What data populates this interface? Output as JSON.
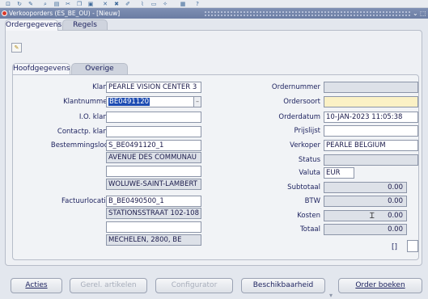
{
  "toolbar": {
    "icons": [
      "save-icon",
      "refresh-icon",
      "pen-icon",
      "zoom-icon",
      "print-icon",
      "cut-icon",
      "copy-icon",
      "paste-icon",
      "clear-icon",
      "delete-icon",
      "edit-icon",
      "attach-icon",
      "folder-icon",
      "help-icon",
      "window-icon",
      "question-icon"
    ]
  },
  "window": {
    "title": "Verkooporders (ES_BE_OU) - [Nieuw]",
    "minimize": "⌄",
    "restore": "⬚"
  },
  "tabs": {
    "ordergegevens": "Ordergegevens",
    "regels": "Regels"
  },
  "subtabs": {
    "hoofdgegevens": "Hoofdgegevens",
    "overige": "Overige"
  },
  "form": {
    "klant": {
      "label": "Klant",
      "value": "PEARLE VISION CENTER 3"
    },
    "klantnummer": {
      "label": "Klantnummer",
      "value": "BE0491120"
    },
    "io_klant": {
      "label": "I.O. klant",
      "value": ""
    },
    "contactp_klant": {
      "label": "Contactp. klant",
      "value": ""
    },
    "bestemmingsloc": {
      "label": "Bestemmingsloc.",
      "value": "S_BE0491120_1"
    },
    "adres_bestemming": [
      "AVENUE DES COMMUNAU",
      "",
      "WOLUWE-SAINT-LAMBERT"
    ],
    "factuurlocatie": {
      "label": "Factuurlocatie",
      "value": "B_BE0490500_1"
    },
    "adres_factuur": [
      "STATIONSSTRAAT 102-108",
      "",
      "MECHELEN, 2800, BE"
    ],
    "ordernummer": {
      "label": "Ordernummer",
      "value": ""
    },
    "ordersoort": {
      "label": "Ordersoort",
      "value": ""
    },
    "orderdatum": {
      "label": "Orderdatum",
      "value": "10-JAN-2023 11:05:38"
    },
    "prijslijst": {
      "label": "Prijslijst",
      "value": ""
    },
    "verkoper": {
      "label": "Verkoper",
      "value": "PEARLE BELGIUM"
    },
    "status": {
      "label": "Status",
      "value": ""
    },
    "valuta": {
      "label": "Valuta",
      "value": "EUR"
    },
    "subtotaal": {
      "label": "Subtotaal",
      "value": "0.00"
    },
    "btw": {
      "label": "BTW",
      "value": "0.00"
    },
    "kosten": {
      "label": "Kosten",
      "value": "0.00"
    },
    "totaal": {
      "label": "Totaal",
      "value": "0.00"
    },
    "checkbox_label": "[]"
  },
  "buttons": {
    "acties": "Acties",
    "gerel_artikelen": "Gerel. artikelen",
    "configurator": "Configurator",
    "beschikbaarheid": "Beschikbaarheid",
    "order_boeken": "Order boeken"
  },
  "colors": {
    "titlebar": "#7384aa",
    "selection": "#1c4bb2",
    "required_field": "#fbf1c5",
    "readonly_field": "#dde1e8"
  }
}
